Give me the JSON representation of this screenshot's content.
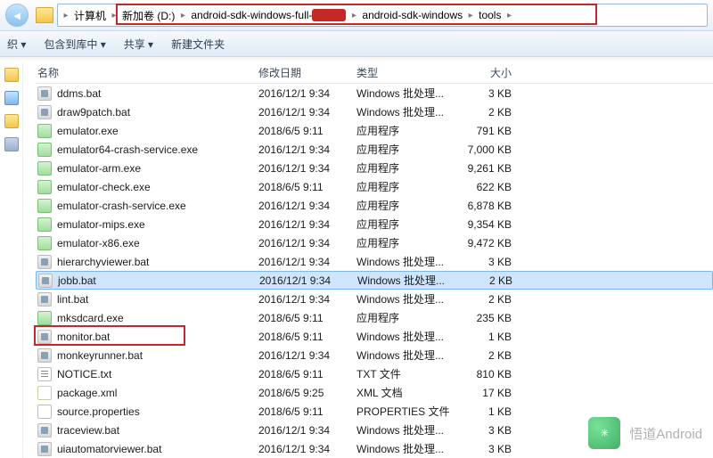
{
  "nav": {
    "back_glyph": "◄"
  },
  "breadcrumb": {
    "items": [
      "计算机",
      "新加卷 (D:)",
      "android-sdk-windows-full-",
      "android-sdk-windows",
      "tools"
    ],
    "arrow": "▸"
  },
  "toolbar": {
    "organize": "织 ▾",
    "include": "包含到库中 ▾",
    "share": "共享 ▾",
    "newfolder": "新建文件夹"
  },
  "columns": {
    "name": "名称",
    "date": "修改日期",
    "type": "类型",
    "size": "大小"
  },
  "files": [
    {
      "icon": "bat",
      "name": "ddms.bat",
      "date": "2016/12/1 9:34",
      "type": "Windows 批处理...",
      "size": "3 KB"
    },
    {
      "icon": "bat",
      "name": "draw9patch.bat",
      "date": "2016/12/1 9:34",
      "type": "Windows 批处理...",
      "size": "2 KB"
    },
    {
      "icon": "exe",
      "name": "emulator.exe",
      "date": "2018/6/5 9:11",
      "type": "应用程序",
      "size": "791 KB"
    },
    {
      "icon": "exe",
      "name": "emulator64-crash-service.exe",
      "date": "2016/12/1 9:34",
      "type": "应用程序",
      "size": "7,000 KB"
    },
    {
      "icon": "exe",
      "name": "emulator-arm.exe",
      "date": "2016/12/1 9:34",
      "type": "应用程序",
      "size": "9,261 KB"
    },
    {
      "icon": "exe",
      "name": "emulator-check.exe",
      "date": "2018/6/5 9:11",
      "type": "应用程序",
      "size": "622 KB"
    },
    {
      "icon": "exe",
      "name": "emulator-crash-service.exe",
      "date": "2016/12/1 9:34",
      "type": "应用程序",
      "size": "6,878 KB"
    },
    {
      "icon": "exe",
      "name": "emulator-mips.exe",
      "date": "2016/12/1 9:34",
      "type": "应用程序",
      "size": "9,354 KB"
    },
    {
      "icon": "exe",
      "name": "emulator-x86.exe",
      "date": "2016/12/1 9:34",
      "type": "应用程序",
      "size": "9,472 KB"
    },
    {
      "icon": "bat",
      "name": "hierarchyviewer.bat",
      "date": "2016/12/1 9:34",
      "type": "Windows 批处理...",
      "size": "3 KB"
    },
    {
      "icon": "bat",
      "name": "jobb.bat",
      "date": "2016/12/1 9:34",
      "type": "Windows 批处理...",
      "size": "2 KB",
      "selected": true
    },
    {
      "icon": "bat",
      "name": "lint.bat",
      "date": "2016/12/1 9:34",
      "type": "Windows 批处理...",
      "size": "2 KB"
    },
    {
      "icon": "exe",
      "name": "mksdcard.exe",
      "date": "2018/6/5 9:11",
      "type": "应用程序",
      "size": "235 KB"
    },
    {
      "icon": "bat",
      "name": "monitor.bat",
      "date": "2018/6/5 9:11",
      "type": "Windows 批处理...",
      "size": "1 KB",
      "highlight": true
    },
    {
      "icon": "bat",
      "name": "monkeyrunner.bat",
      "date": "2016/12/1 9:34",
      "type": "Windows 批处理...",
      "size": "2 KB"
    },
    {
      "icon": "txt",
      "name": "NOTICE.txt",
      "date": "2018/6/5 9:11",
      "type": "TXT 文件",
      "size": "810 KB"
    },
    {
      "icon": "xml",
      "name": "package.xml",
      "date": "2018/6/5 9:25",
      "type": "XML 文档",
      "size": "17 KB"
    },
    {
      "icon": "prop",
      "name": "source.properties",
      "date": "2018/6/5 9:11",
      "type": "PROPERTIES 文件",
      "size": "1 KB"
    },
    {
      "icon": "bat",
      "name": "traceview.bat",
      "date": "2016/12/1 9:34",
      "type": "Windows 批处理...",
      "size": "3 KB"
    },
    {
      "icon": "bat",
      "name": "uiautomatorviewer.bat",
      "date": "2016/12/1 9:34",
      "type": "Windows 批处理...",
      "size": "3 KB"
    }
  ],
  "watermark": {
    "text": "悟道Android"
  }
}
